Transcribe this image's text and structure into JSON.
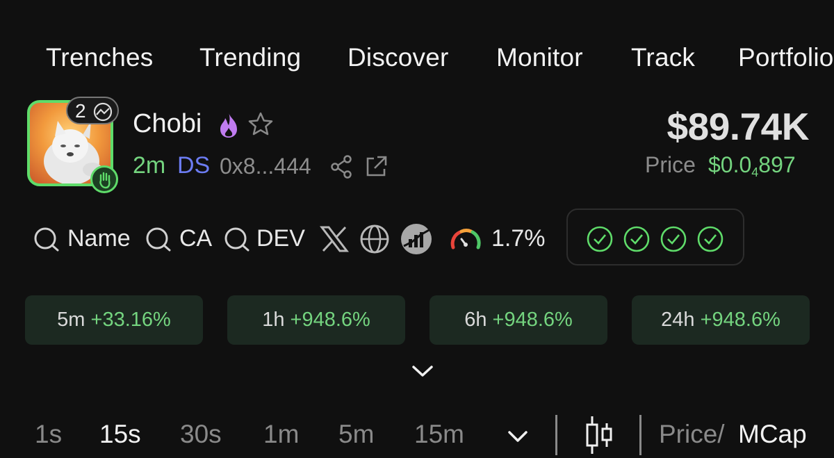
{
  "nav": {
    "items": [
      "Trenches",
      "Trending",
      "Discover",
      "Monitor",
      "Track",
      "Portfolio"
    ]
  },
  "token": {
    "name": "Chobi",
    "holders_count": "2",
    "age": "2m",
    "dex_label": "DS",
    "address": "0x8...444",
    "icons": [
      "fire-icon",
      "star-icon",
      "share-icon",
      "external-link-icon",
      "hand-badge-icon"
    ]
  },
  "market": {
    "mcap": "$89.74K",
    "price_label": "Price",
    "price_prefix": "$0.0",
    "price_zeros": "4",
    "price_digits": "897"
  },
  "tools": {
    "name_label": "Name",
    "ca_label": "CA",
    "dev_label": "DEV",
    "risk_value": "1.7%",
    "icons": [
      "search-icon",
      "x-icon",
      "globe-icon",
      "chart-logo-icon",
      "gauge-icon"
    ],
    "checks_count": 4
  },
  "changes": [
    {
      "period": "5m",
      "value": "+33.16%"
    },
    {
      "period": "1h",
      "value": "+948.6%"
    },
    {
      "period": "6h",
      "value": "+948.6%"
    },
    {
      "period": "24h",
      "value": "+948.6%"
    }
  ],
  "timeframes": {
    "items": [
      "1s",
      "15s",
      "30s",
      "1m",
      "5m",
      "15m"
    ],
    "active": "15s"
  },
  "price_mcap": {
    "price": "Price/",
    "mcap": "MCap"
  },
  "colors": {
    "background": "#101010",
    "accent_green": "#74d47f",
    "ds_blue": "#6c7cf2",
    "fire_purple": "#c07cf0",
    "change_card": "#1c2921"
  }
}
